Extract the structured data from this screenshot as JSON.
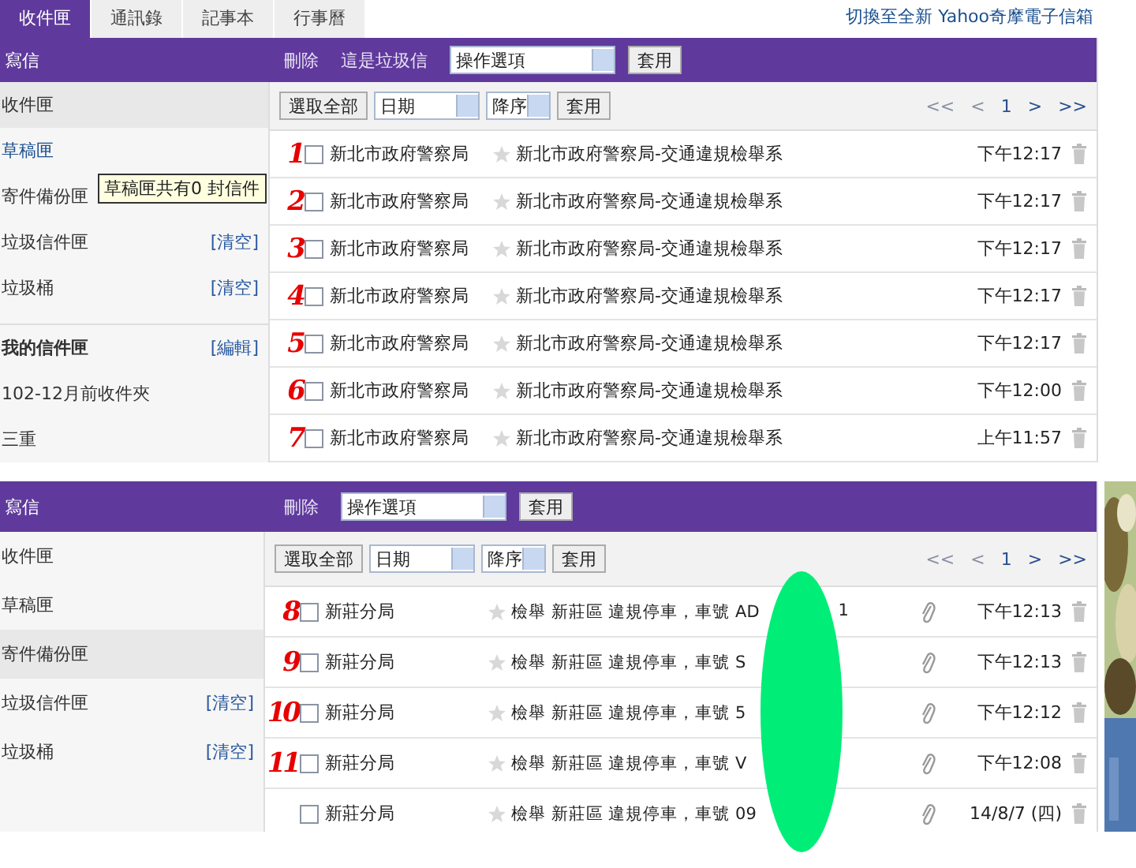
{
  "panels": [
    {
      "tabs": [
        {
          "label": "收件匣",
          "selected": true
        },
        {
          "label": "通訊錄",
          "selected": false
        },
        {
          "label": "記事本",
          "selected": false
        },
        {
          "label": "行事曆",
          "selected": false
        }
      ],
      "switch_link": "切換至全新 Yahoo奇摩電子信箱",
      "compose": "寫信",
      "actions": [
        "刪除",
        "這是垃圾信"
      ],
      "action_select": "操作選項",
      "action_apply": "套用",
      "select_all": "選取全部",
      "sort_field": "日期",
      "sort_order": "降序",
      "sort_apply": "套用",
      "pager": [
        {
          "label": "<<",
          "disabled": true
        },
        {
          "label": "<",
          "disabled": true
        },
        {
          "label": "1",
          "disabled": false
        },
        {
          "label": ">",
          "disabled": false
        },
        {
          "label": ">>",
          "disabled": false
        }
      ],
      "folders": [
        {
          "kind": "folder",
          "label": "收件匣",
          "selected": true,
          "hovered": false
        },
        {
          "kind": "folder",
          "label": "草稿匣",
          "selected": false,
          "hovered": true
        },
        {
          "kind": "folder",
          "label": "寄件備份匣",
          "selected": false,
          "hovered": false
        },
        {
          "kind": "folder",
          "label": "垃圾信件匣",
          "action": "[清空]",
          "selected": false,
          "hovered": false
        },
        {
          "kind": "folder",
          "label": "垃圾桶",
          "action": "[清空]",
          "selected": false,
          "hovered": false
        },
        {
          "kind": "heading",
          "label": "我的信件匣",
          "action": "[編輯]",
          "selected": false,
          "hovered": false
        },
        {
          "kind": "folder",
          "label": "102-12月前收件夾",
          "selected": false,
          "hovered": false
        },
        {
          "kind": "folder",
          "label": "三重",
          "selected": false,
          "hovered": false
        }
      ],
      "tooltip": "草稿匣共有0 封信件",
      "messages": [
        {
          "annotation": "1",
          "checked": false,
          "sender": "新北市政府警察局",
          "starred": false,
          "subject": "新北市政府警察局-交通違規檢舉系",
          "attachment": false,
          "time": "下午12:17"
        },
        {
          "annotation": "2",
          "checked": false,
          "sender": "新北市政府警察局",
          "starred": false,
          "subject": "新北市政府警察局-交通違規檢舉系",
          "attachment": false,
          "time": "下午12:17"
        },
        {
          "annotation": "3",
          "checked": false,
          "sender": "新北市政府警察局",
          "starred": false,
          "subject": "新北市政府警察局-交通違規檢舉系",
          "attachment": false,
          "time": "下午12:17"
        },
        {
          "annotation": "4",
          "checked": false,
          "sender": "新北市政府警察局",
          "starred": false,
          "subject": "新北市政府警察局-交通違規檢舉系",
          "attachment": false,
          "time": "下午12:17"
        },
        {
          "annotation": "5",
          "checked": false,
          "sender": "新北市政府警察局",
          "starred": false,
          "subject": "新北市政府警察局-交通違規檢舉系",
          "attachment": false,
          "time": "下午12:17"
        },
        {
          "annotation": "6",
          "checked": false,
          "sender": "新北市政府警察局",
          "starred": false,
          "subject": "新北市政府警察局-交通違規檢舉系",
          "attachment": false,
          "time": "下午12:00"
        },
        {
          "annotation": "7",
          "checked": false,
          "sender": "新北市政府警察局",
          "starred": false,
          "subject": "新北市政府警察局-交通違規檢舉系",
          "attachment": false,
          "time": "上午11:57"
        }
      ]
    },
    {
      "compose": "寫信",
      "actions": [
        "刪除"
      ],
      "action_select": "操作選項",
      "action_apply": "套用",
      "select_all": "選取全部",
      "sort_field": "日期",
      "sort_order": "降序",
      "sort_apply": "套用",
      "pager": [
        {
          "label": "<<",
          "disabled": true
        },
        {
          "label": "<",
          "disabled": true
        },
        {
          "label": "1",
          "disabled": false
        },
        {
          "label": ">",
          "disabled": false
        },
        {
          "label": ">>",
          "disabled": false
        }
      ],
      "folders": [
        {
          "kind": "folder",
          "label": "收件匣",
          "selected": false,
          "hovered": false
        },
        {
          "kind": "folder",
          "label": "草稿匣",
          "selected": false,
          "hovered": false
        },
        {
          "kind": "folder",
          "label": "寄件備份匣",
          "selected": true,
          "hovered": false
        },
        {
          "kind": "folder",
          "label": "垃圾信件匣",
          "action": "[清空]",
          "selected": false,
          "hovered": false
        },
        {
          "kind": "folder",
          "label": "垃圾桶",
          "action": "[清空]",
          "selected": false,
          "hovered": false
        }
      ],
      "messages": [
        {
          "annotation": "8",
          "checked": false,
          "sender": "新莊分局",
          "starred": false,
          "subject": "檢舉 新莊區 違規停車，車號 AD",
          "subject_tail": "1",
          "attachment": true,
          "time": "下午12:13"
        },
        {
          "annotation": "9",
          "checked": false,
          "sender": "新莊分局",
          "starred": false,
          "subject": "檢舉 新莊區 違規停車，車號 S",
          "attachment": true,
          "time": "下午12:13"
        },
        {
          "annotation": "10",
          "checked": false,
          "sender": "新莊分局",
          "starred": false,
          "subject": "檢舉 新莊區 違規停車，車號 5",
          "attachment": true,
          "time": "下午12:12"
        },
        {
          "annotation": "11",
          "checked": false,
          "sender": "新莊分局",
          "starred": false,
          "subject": "檢舉 新莊區 違規停車，車號 V",
          "attachment": true,
          "time": "下午12:08"
        },
        {
          "checked": false,
          "sender": "新莊分局",
          "starred": false,
          "subject": "檢舉 新莊區 違規停車，車號 09",
          "attachment": true,
          "time": "14/8/7 (四)"
        }
      ],
      "side_picture": {
        "kind": "picture"
      }
    }
  ],
  "redaction_mark": true
}
